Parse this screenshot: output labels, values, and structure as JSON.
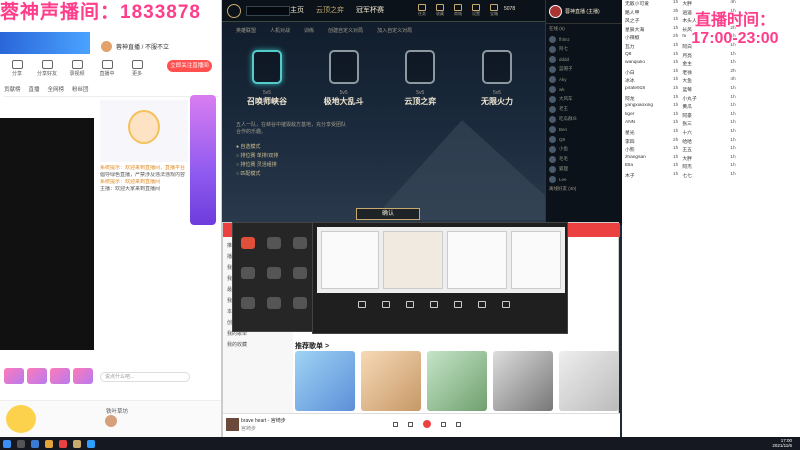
{
  "overlay": {
    "title": "蓉神声播间：1833878",
    "time_label": "直播时间：",
    "time_range": "17:00-23:00"
  },
  "live": {
    "streamer_name": "蓉神直播 / 不服不立",
    "follow": "立即关注直播间",
    "toolbar": [
      "分享",
      "分享好友",
      "录视频",
      "直播中",
      "更多"
    ],
    "tabs": [
      "贡献榜",
      "直播",
      "全网榜",
      "粉丝团"
    ],
    "chat": [
      "系统提示：欢迎来到直播间，直播平台",
      "倡导绿色直播，严禁涉及违法违规内容",
      "系统提示：欢迎来到直播间",
      "主播：欢迎大家来到直播间"
    ],
    "input_placeholder": "说点什么吧...",
    "bottom_name": "铁叶草坊"
  },
  "game": {
    "nav": [
      "主页",
      "云顶之弈",
      "冠军杯赛"
    ],
    "nav_active": 1,
    "icons": [
      "任务",
      "收藏",
      "商城",
      "设置",
      "宝箱"
    ],
    "currency": "5078",
    "subtabs": [
      "英雄联盟",
      "人机对战",
      "训练",
      "创建自定义对局",
      "加入自定义对局"
    ],
    "modes": [
      {
        "count": "5v5",
        "name": "召唤师峡谷"
      },
      {
        "count": "5v5",
        "name": "极地大乱斗"
      },
      {
        "count": "5v5",
        "name": "云顶之弈"
      },
      {
        "count": "5v5",
        "name": "无限火力"
      }
    ],
    "desc": "五人一队，在峡谷中摧毁敌方基地，充分享受团队合作的乐趣。",
    "options": [
      "● 自选模式",
      "○ 排位赛 单排/双排",
      "○ 排位赛 灵活组排",
      "○ 匹配模式"
    ],
    "confirm": "确认"
  },
  "friends": {
    "name": "蓉神直播 (主播)",
    "group_online": "在线 (6)",
    "group_other": "离线好友 (40)",
    "list": [
      "fhlmz",
      "阿七",
      "dddd",
      "蓝帽子",
      "Aky",
      "wk",
      "大风车",
      "老王",
      "吃瓜群众",
      "Ben",
      "Q8",
      "小鱼",
      "毛毛",
      "狐狸",
      "Lee"
    ]
  },
  "chatlist": [
    [
      "无敌小可爱",
      "1h",
      "大胖",
      "4h"
    ],
    [
      "路人甲",
      "3h",
      "逍遥",
      "1h"
    ],
    [
      "风之子",
      "1h",
      "木头人",
      "1h"
    ],
    [
      "星辰大海",
      "1h",
      "长风",
      "2h"
    ],
    [
      "小辣椒",
      "2h",
      "hi",
      "1h"
    ],
    [
      "瓦力",
      "1h",
      "阿白",
      "1h"
    ],
    [
      "Q8",
      "1h",
      "月亮",
      "1h"
    ],
    [
      "wanqiulio",
      "1h",
      "金主",
      "1h"
    ],
    [
      "小白",
      "1h",
      "老徐",
      "2h"
    ],
    [
      "冰冰",
      "1h",
      "大鱼",
      "4h"
    ],
    [
      "pirate918",
      "1h",
      "蓝莓",
      "1h"
    ],
    [
      "阿龙",
      "1h",
      "小丸子",
      "1h"
    ],
    [
      "yangxiaoxing",
      "1h",
      "黄瓜",
      "1h"
    ],
    [
      "tiger",
      "1h",
      "阿豪",
      "1h"
    ],
    [
      "ANN",
      "1h",
      "张三",
      "1h"
    ],
    [
      "星光",
      "1h",
      "十六",
      "1h"
    ],
    [
      "李四",
      "2h",
      "哈哈",
      "1h"
    ],
    [
      "小熊",
      "1h",
      "王五",
      "1h"
    ],
    [
      "zhangsan",
      "1h",
      "大胖",
      "1h"
    ],
    [
      "Ella",
      "1h",
      "阿杰",
      "1h"
    ],
    [
      "木子",
      "1h",
      "七七",
      "1h"
    ]
  ],
  "music": {
    "sidebar": [
      "推荐",
      "播客",
      "我的音乐",
      "我喜欢的音乐",
      "最近播放",
      "我的播客",
      "本地与下载",
      "创建的歌单",
      "我的歌单",
      "我的收藏"
    ],
    "recommend_title": "推荐歌单 >",
    "song_title": "brave heart - 宫崎步",
    "song_artist": "宫崎步"
  },
  "taskbar": {
    "time": "17:00",
    "date": "2021/11/6"
  }
}
